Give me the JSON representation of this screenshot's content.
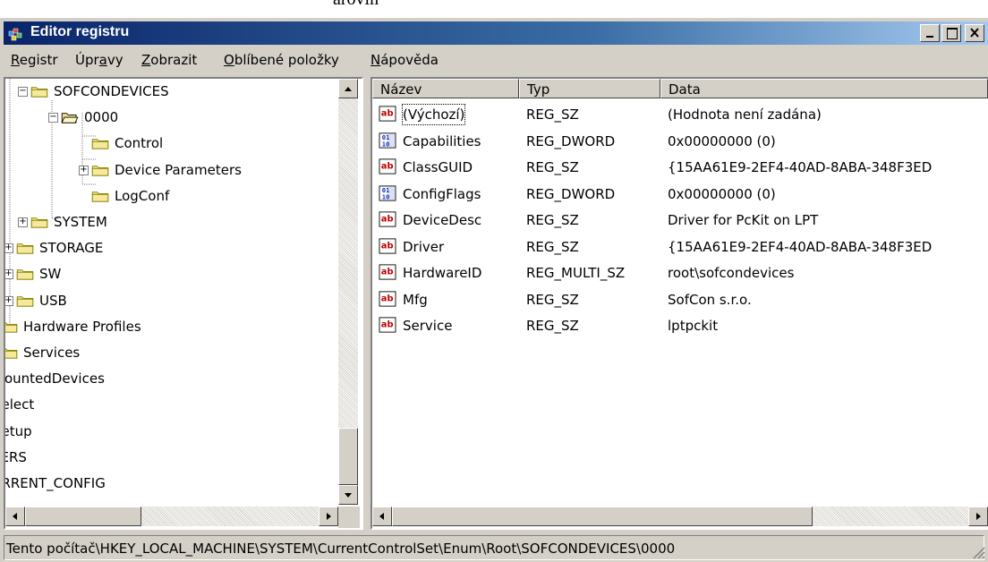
{
  "document_fragment": "árovin",
  "window": {
    "title": "Editor registru",
    "controls": {
      "minimize": "minimize",
      "maximize": "maximize",
      "close": "close"
    }
  },
  "menu": {
    "items": [
      {
        "label": "Registr",
        "underline": "R"
      },
      {
        "label": "Úpravy",
        "underline": "a"
      },
      {
        "label": "Zobrazit",
        "underline": "Z"
      },
      {
        "label": "Oblíbené položky",
        "underline": "O"
      },
      {
        "label": "Nápověda",
        "underline": "N"
      }
    ]
  },
  "tree": {
    "nodes": [
      {
        "label": "SOFCONDEVICES",
        "level": 4,
        "expander": "−",
        "folder": "closed"
      },
      {
        "label": "0000",
        "level": 5,
        "expander": "−",
        "folder": "open"
      },
      {
        "label": "Control",
        "level": 6,
        "expander": "",
        "folder": "closed"
      },
      {
        "label": "Device Parameters",
        "level": 6,
        "expander": "+",
        "folder": "closed"
      },
      {
        "label": "LogConf",
        "level": 6,
        "expander": "",
        "folder": "closed"
      },
      {
        "label": "SYSTEM",
        "level": 4,
        "expander": "+",
        "folder": "closed"
      },
      {
        "label": "STORAGE",
        "level": 3,
        "expander": "+",
        "folder": "closed"
      },
      {
        "label": "SW",
        "level": 3,
        "expander": "+",
        "folder": "closed"
      },
      {
        "label": "USB",
        "level": 3,
        "expander": "+",
        "folder": "closed"
      },
      {
        "label": "Hardware Profiles",
        "level": 2,
        "expander": "",
        "folder": "closed"
      },
      {
        "label": "Services",
        "level": 2,
        "expander": "",
        "folder": "closed"
      },
      {
        "label": "MountedDevices",
        "level": 1,
        "expander": "",
        "folder": "none"
      },
      {
        "label": "Select",
        "level": 1,
        "expander": "",
        "folder": "none"
      },
      {
        "label": "Setup",
        "level": 1,
        "expander": "",
        "folder": "none"
      },
      {
        "label": "USERS",
        "level": 0,
        "expander": "",
        "folder": "none"
      },
      {
        "label": "CURRENT_CONFIG",
        "level": 0,
        "expander": "",
        "folder": "none"
      }
    ]
  },
  "list": {
    "columns": [
      "Název",
      "Typ",
      "Data"
    ],
    "rows": [
      {
        "name": "(Výchozí)",
        "type": "REG_SZ",
        "data": "(Hodnota není zadána)",
        "icon": "string-value-icon"
      },
      {
        "name": "Capabilities",
        "type": "REG_DWORD",
        "data": "0x00000000 (0)",
        "icon": "binary-value-icon"
      },
      {
        "name": "ClassGUID",
        "type": "REG_SZ",
        "data": "{15AA61E9-2EF4-40AD-8ABA-348F3ED",
        "icon": "string-value-icon"
      },
      {
        "name": "ConfigFlags",
        "type": "REG_DWORD",
        "data": "0x00000000 (0)",
        "icon": "binary-value-icon"
      },
      {
        "name": "DeviceDesc",
        "type": "REG_SZ",
        "data": "Driver for PcKit on LPT",
        "icon": "string-value-icon"
      },
      {
        "name": "Driver",
        "type": "REG_SZ",
        "data": "{15AA61E9-2EF4-40AD-8ABA-348F3ED",
        "icon": "string-value-icon"
      },
      {
        "name": "HardwareID",
        "type": "REG_MULTI_SZ",
        "data": "root\\sofcondevices",
        "icon": "string-value-icon"
      },
      {
        "name": "Mfg",
        "type": "REG_SZ",
        "data": "SofCon s.r.o.",
        "icon": "string-value-icon"
      },
      {
        "name": "Service",
        "type": "REG_SZ",
        "data": "lptpckit",
        "icon": "string-value-icon"
      }
    ]
  },
  "status": {
    "path": "Tento počítač\\HKEY_LOCAL_MACHINE\\SYSTEM\\CurrentControlSet\\Enum\\Root\\SOFCONDEVICES\\0000"
  },
  "colors": {
    "title_gradient_start": "#0a246a",
    "title_gradient_end": "#a6caf0",
    "face": "#d4d0c8",
    "folder": "#f5e08a"
  }
}
